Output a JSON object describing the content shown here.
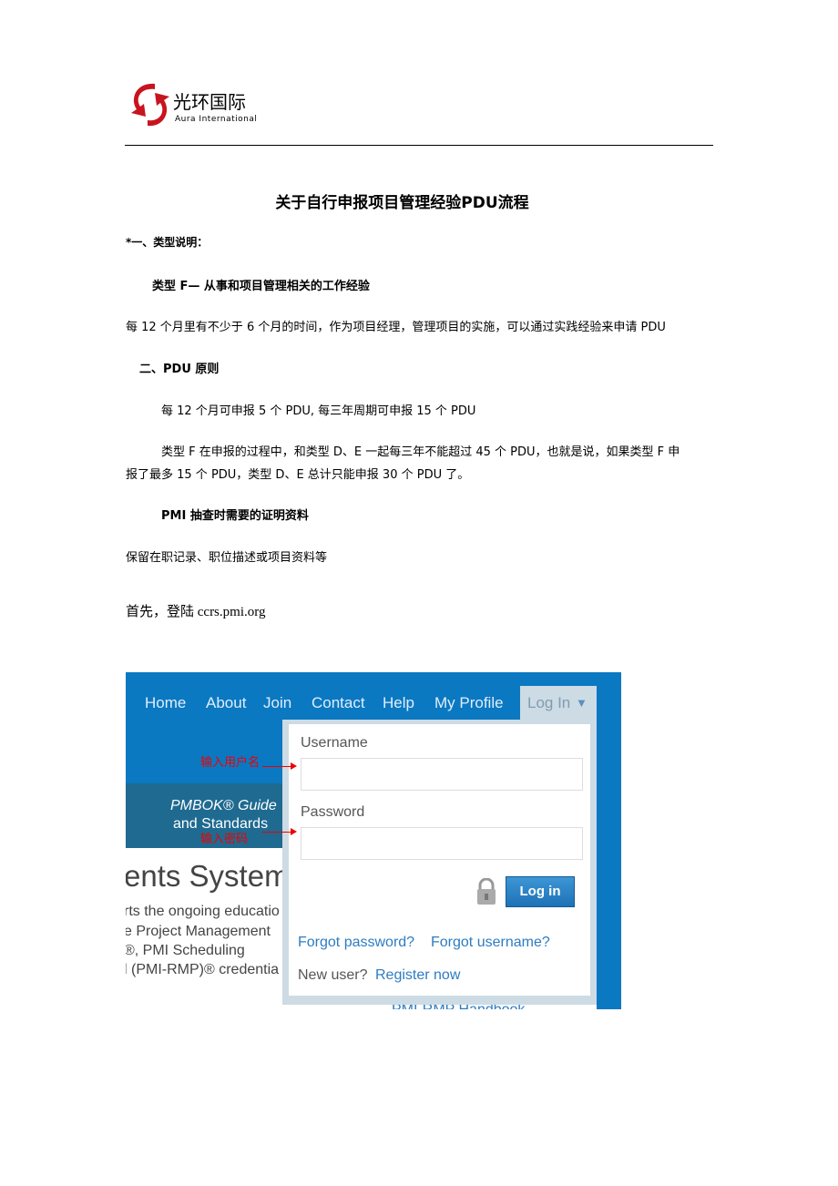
{
  "logo": {
    "cn": "光环国际",
    "en": "Aura International",
    "color": "#c8141e"
  },
  "doc": {
    "title": "关于自行申报项目管理经验PDU流程",
    "s1": "*一、类型说明：",
    "s1_sub": "类型 F— 从事和项目管理相关的工作经验",
    "s1_text": "每 12 个月里有不少于 6 个月的时间，作为项目经理，管理项目的实施，可以通过实践经验来申请 PDU",
    "s2": "二、PDU 原则",
    "s2_p1": "每 12 个月可申报 5 个 PDU, 每三年周期可申报 15 个 PDU",
    "s2_p2a": "类型 F 在申报的过程中，和类型 D、E 一起每三年不能超过 45 个 PDU，也就是说，如果类型 F 申",
    "s2_p2b": "报了最多 15 个 PDU，类型 D、E 总计只能申报 30 个 PDU 了。",
    "s3": "PMI  抽查时需要的证明资料",
    "s3_text": "保留在职记录、职位描述或项目资料等",
    "step1": "首先，登陆  ccrs.pmi.org"
  },
  "screenshot": {
    "nav": [
      "Home",
      "About",
      "Join",
      "Contact",
      "Help",
      "My Profile"
    ],
    "login_tab": "Log In",
    "banner": {
      "line1": "PMBOK® Guide",
      "line2": "and Standards"
    },
    "heading": "ents System",
    "body": [
      "rts the ongoing educatio",
      "e Project Management",
      "®, PMI Scheduling",
      "l (PMI-RMP)® credentia"
    ],
    "bottom_link": "PMI-RMP Handbook",
    "username_label": "Username",
    "password_label": "Password",
    "login_button": "Log in",
    "forgot_password": "Forgot password?",
    "forgot_username": "Forgot username?",
    "new_user": "New user?",
    "register": "Register now",
    "annot_username": "输入用户名",
    "annot_password": "输入密码"
  }
}
